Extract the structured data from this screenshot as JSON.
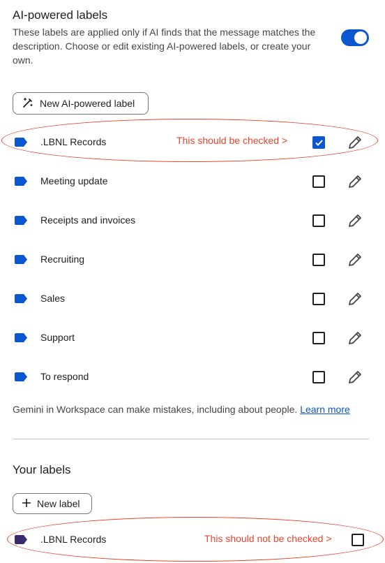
{
  "ai_section": {
    "title": "AI-powered labels",
    "description": "These labels are applied only if AI finds that the message matches the description. Choose or edit existing AI-powered labels, or create your own.",
    "toggle_on": true,
    "new_button_label": "New AI-powered label",
    "items": [
      {
        "label": ".LBNL Records",
        "checked": true
      },
      {
        "label": "Meeting update",
        "checked": false
      },
      {
        "label": "Receipts and invoices",
        "checked": false
      },
      {
        "label": "Recruiting",
        "checked": false
      },
      {
        "label": "Sales",
        "checked": false
      },
      {
        "label": "Support",
        "checked": false
      },
      {
        "label": "To respond",
        "checked": false
      }
    ],
    "disclaimer": "Gemini in Workspace can make mistakes, including about people.",
    "learn_more": "Learn more"
  },
  "your_labels": {
    "title": "Your labels",
    "new_button_label": "New label",
    "items": [
      {
        "label": ".LBNL Records",
        "checked": false
      }
    ]
  },
  "annotations": {
    "checked_note": "This should be checked >",
    "unchecked_note": "This should not be checked >"
  },
  "colors": {
    "accent": "#0b57d0",
    "tag_ai": "#0b57d0",
    "tag_user": "#3c2a6e",
    "annotation": "#e8442d"
  }
}
